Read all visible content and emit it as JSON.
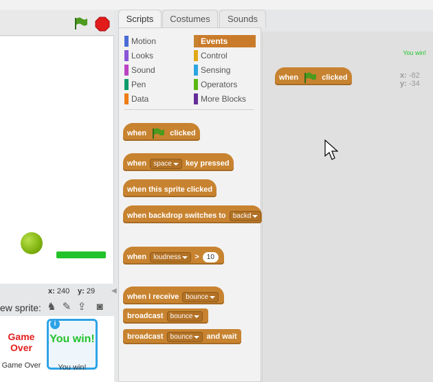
{
  "tabs": [
    {
      "label": "Scripts",
      "active": true
    },
    {
      "label": "Costumes",
      "active": false
    },
    {
      "label": "Sounds",
      "active": false
    }
  ],
  "stage": {
    "mouse_x_label": "x:",
    "mouse_x": "240",
    "mouse_y_label": "y:",
    "mouse_y": "29"
  },
  "sprites": {
    "new_sprite_label": "ew sprite:",
    "items": [
      {
        "name": "Game Over",
        "art_text": "Game Over",
        "selected": false
      },
      {
        "name": "You win!",
        "art_text": "You win!",
        "selected": true
      }
    ]
  },
  "categories": {
    "left": [
      {
        "label": "Motion",
        "color": "#4a6cd4"
      },
      {
        "label": "Looks",
        "color": "#8a55d7"
      },
      {
        "label": "Sound",
        "color": "#bb42c3"
      },
      {
        "label": "Pen",
        "color": "#0e9a6c"
      },
      {
        "label": "Data",
        "color": "#ee7d16"
      }
    ],
    "right": [
      {
        "label": "Events",
        "color": "#c88330",
        "selected": true
      },
      {
        "label": "Control",
        "color": "#e1a91a"
      },
      {
        "label": "Sensing",
        "color": "#2ca5e2"
      },
      {
        "label": "Operators",
        "color": "#5cb712"
      },
      {
        "label": "More Blocks",
        "color": "#632d99"
      }
    ]
  },
  "blocks": {
    "when": "when",
    "clicked": "clicked",
    "key_pressed": "key pressed",
    "space": "space",
    "sprite_clicked": "when this sprite clicked",
    "backdrop_switches": "when backdrop switches to",
    "backdrop_value": "backd",
    "loudness": "loudness",
    "gt": ">",
    "loudness_value": "10",
    "i_receive": "when I receive",
    "message": "bounce",
    "broadcast": "broadcast",
    "and_wait": "and wait"
  },
  "script_area": {
    "sprite_name": "You win!",
    "x_label": "x:",
    "x": "-82",
    "y_label": "y:",
    "y": "-34"
  },
  "colors": {
    "events": "#c88330",
    "selected_sprite_border": "#2ea3e6"
  }
}
